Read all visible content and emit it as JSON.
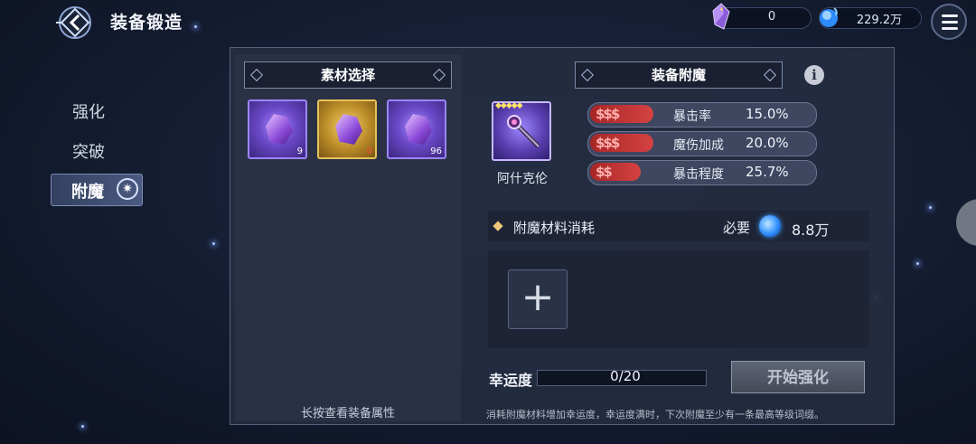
{
  "header": {
    "title": "装备锻造",
    "crystal_value": "0",
    "gold_value": "229.2万"
  },
  "nav": {
    "items": [
      {
        "label": "强化"
      },
      {
        "label": "突破"
      },
      {
        "label": "附魔"
      }
    ],
    "active": "附魔"
  },
  "materials": {
    "title": "素材选择",
    "slots": [
      {
        "count": "9",
        "style": "purple"
      },
      {
        "count": "0",
        "style": "gold"
      },
      {
        "count": "96",
        "style": "purple"
      }
    ],
    "hint": "长按查看装备属性"
  },
  "enchant": {
    "title": "装备附魔",
    "equipment_name": "阿什克伦",
    "stats": [
      {
        "tag": "$$$",
        "name": "暴击率",
        "value": "15.0%"
      },
      {
        "tag": "$$$",
        "name": "魔伤加成",
        "value": "20.0%"
      },
      {
        "tag": "$$",
        "name": "暴击程度",
        "value": "25.7%"
      }
    ],
    "cost_label": "附魔材料消耗",
    "required_label": "必要",
    "required_value": "8.8万",
    "add_symbol": "+",
    "luck_label": "幸运度",
    "luck_value": "0/20",
    "start_button": "开始强化",
    "hint": "消耗附魔材料增加幸运度，幸运度满时，下次附魔至少有一条最高等级词缀。",
    "info_symbol": "i"
  },
  "colors": {
    "accent_purple": "#6b49c8",
    "accent_gold": "#b98a27",
    "stat_red": "#d54242"
  }
}
